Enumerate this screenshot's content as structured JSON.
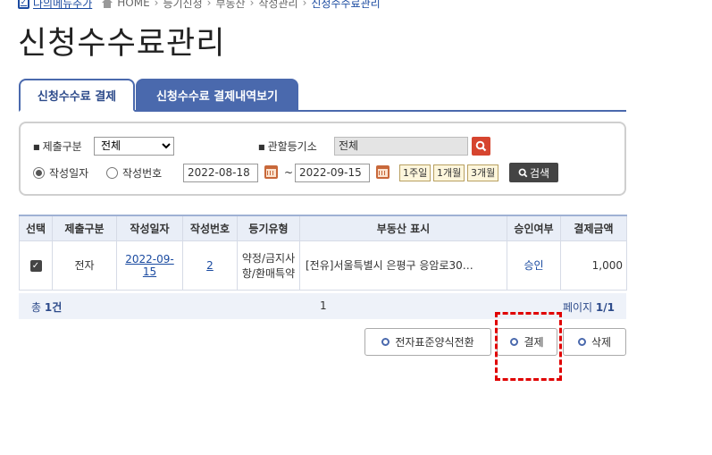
{
  "topbar": {
    "my_menu_label": "나의메뉴추가",
    "breadcrumb": [
      "HOME",
      "등기신청",
      "부동산",
      "작성관리"
    ],
    "current": "신청수수료관리"
  },
  "page_title": "신청수수료관리",
  "tabs": [
    {
      "label": "신청수수료 결제",
      "active": true
    },
    {
      "label": "신청수수료 결제내역보기",
      "active": false
    }
  ],
  "search": {
    "submit_type_label": "제출구분",
    "submit_type_value": "전체",
    "office_label": "관할등기소",
    "office_value": "전체",
    "radio_date_label": "작성일자",
    "radio_number_label": "작성번호",
    "date_from": "2022-08-18",
    "date_to": "2022-09-15",
    "tilde": "~",
    "period_buttons": [
      "1주일",
      "1개월",
      "3개월"
    ],
    "search_button": "검색"
  },
  "table": {
    "headers": [
      "선택",
      "제출구분",
      "작성일자",
      "작성번호",
      "등기유형",
      "부동산 표시",
      "승인여부",
      "결제금액"
    ],
    "rows": [
      {
        "selected": true,
        "submit_type": "전자",
        "date": "2022-09-15",
        "number": "2",
        "reg_type": "약정/금지사항/환매특약",
        "property": "[전유]서울특별시 은평구 응암로30…",
        "approval": "승인",
        "amount": "1,000"
      }
    ]
  },
  "footer": {
    "total_prefix": "총 ",
    "total_count": "1건",
    "page_number": "1",
    "page_label": "페이지 ",
    "page_value": "1/1"
  },
  "actions": {
    "convert": "전자표준양식전환",
    "pay": "결제",
    "delete": "삭제"
  },
  "colors": {
    "accent": "#4a69ad",
    "highlight": "#e00000",
    "search_icon_bg": "#d6452f"
  }
}
